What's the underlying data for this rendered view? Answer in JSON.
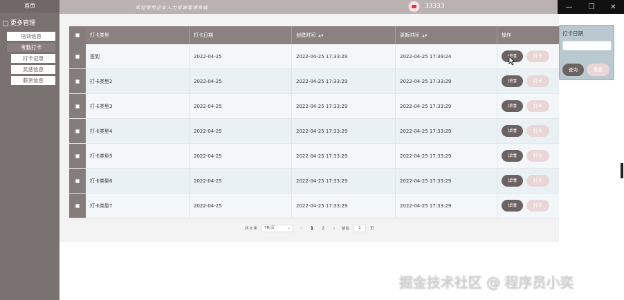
{
  "sidebar": {
    "home": "首页",
    "group": "更多管理",
    "items": [
      {
        "label": "培训信息",
        "active": false,
        "sub": false
      },
      {
        "label": "考勤打卡",
        "active": true,
        "sub": false
      },
      {
        "label": "打卡记录",
        "active": false,
        "sub": true
      },
      {
        "label": "奖惩信息",
        "active": false,
        "sub": true
      },
      {
        "label": "薪资信息",
        "active": false,
        "sub": true
      }
    ]
  },
  "header": {
    "welcome": "欢迎使用企业人力资源管理系统",
    "user": "33333"
  },
  "window_controls": {
    "minimize": "—",
    "maximize": "❐",
    "close": "✕"
  },
  "table": {
    "columns": [
      "打卡类型",
      "打卡日期",
      "创建时间",
      "更新时间",
      "操作"
    ],
    "rows": [
      [
        "签到",
        "2022-04-25",
        "2022-04-25 17:33:29",
        "2022-04-25 17:39:24"
      ],
      [
        "打卡类型2",
        "2022-04-25",
        "2022-04-25 17:33:29",
        "2022-04-25 17:33:29"
      ],
      [
        "打卡类型3",
        "2022-04-25",
        "2022-04-25 17:33:29",
        "2022-04-25 17:33:29"
      ],
      [
        "打卡类型4",
        "2022-04-25",
        "2022-04-25 17:33:29",
        "2022-04-25 17:33:29"
      ],
      [
        "打卡类型5",
        "2022-04-25",
        "2022-04-25 17:33:29",
        "2022-04-25 17:33:29"
      ],
      [
        "打卡类型6",
        "2022-04-25",
        "2022-04-25 17:33:29",
        "2022-04-25 17:33:29"
      ],
      [
        "打卡类型7",
        "2022-04-25",
        "2022-04-25 17:33:29",
        "2022-04-25 17:33:29"
      ]
    ],
    "detail_label": "详情",
    "punch_label": "打卡"
  },
  "pager": {
    "total": "共 8 条",
    "page_size": "7条/页",
    "pages": [
      "1",
      "2"
    ],
    "prev": "‹",
    "next": "›",
    "goto_label": "前往",
    "goto_value": "1",
    "page_unit": "页"
  },
  "search": {
    "label": "打卡日期",
    "query": "查询",
    "reset": "重置"
  },
  "watermark": "掘金技术社区 @ 程序员小奕"
}
